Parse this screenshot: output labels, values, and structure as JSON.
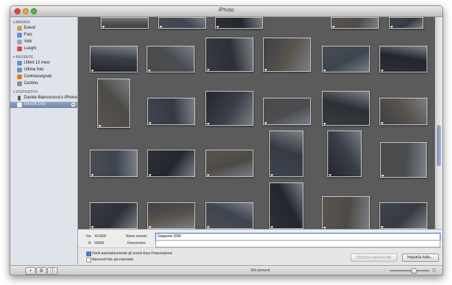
{
  "window": {
    "title": "iPhoto"
  },
  "sidebar": {
    "library_header": "LIBRERIA",
    "library": [
      {
        "label": "Eventi",
        "icon": "events-icon",
        "color": "#c9a14a"
      },
      {
        "label": "Foto",
        "icon": "photos-icon",
        "color": "#5b8ed6"
      },
      {
        "label": "Volti",
        "icon": "faces-icon",
        "color": "#9aa6b6"
      },
      {
        "label": "Luoghi",
        "icon": "places-icon",
        "color": "#d84848"
      }
    ],
    "recent_header": "RECENTE",
    "recent": [
      {
        "label": "Ultimi 12 mesi",
        "icon": "calendar-icon",
        "color": "#6f8fc2"
      },
      {
        "label": "Ultime foto",
        "icon": "last-import-icon",
        "color": "#6f8fc2"
      },
      {
        "label": "Contrassegnati",
        "icon": "flag-icon",
        "color": "#e07b22"
      },
      {
        "label": "Cestino",
        "icon": "trash-icon",
        "color": "#8d8d8d"
      }
    ],
    "devices_header": "DISPOSITIVI",
    "devices": [
      {
        "label": "Davide Biancorosso's iPhone",
        "icon": "iphone-icon",
        "color": "#555555"
      },
      {
        "label": "NIKON D90",
        "icon": "camera-icon",
        "color": "#f0f0f0"
      }
    ],
    "footer": {
      "add": "+",
      "gear": "⚙",
      "info": "ⓘ"
    }
  },
  "import": {
    "from_label": "Da:",
    "from_date": "4/13/09",
    "to_label": "A:",
    "to_date": "6/9/09",
    "event_label": "Nome evento:",
    "event_value": "Giappone 2009",
    "desc_label": "Descrizione:",
    "desc_value": "",
    "split_label": "Dividi automaticamente gli eventi dopo l'importazione",
    "hide_label": "Nascondi foto già importate",
    "import_selected": "Importa selezionati",
    "import_all": "Importa tutto..."
  },
  "status": {
    "count": "364 elementi",
    "zoom": 0.6
  },
  "colors": {
    "grid": "#5b5b5b",
    "selection": "#7a8fb2"
  }
}
